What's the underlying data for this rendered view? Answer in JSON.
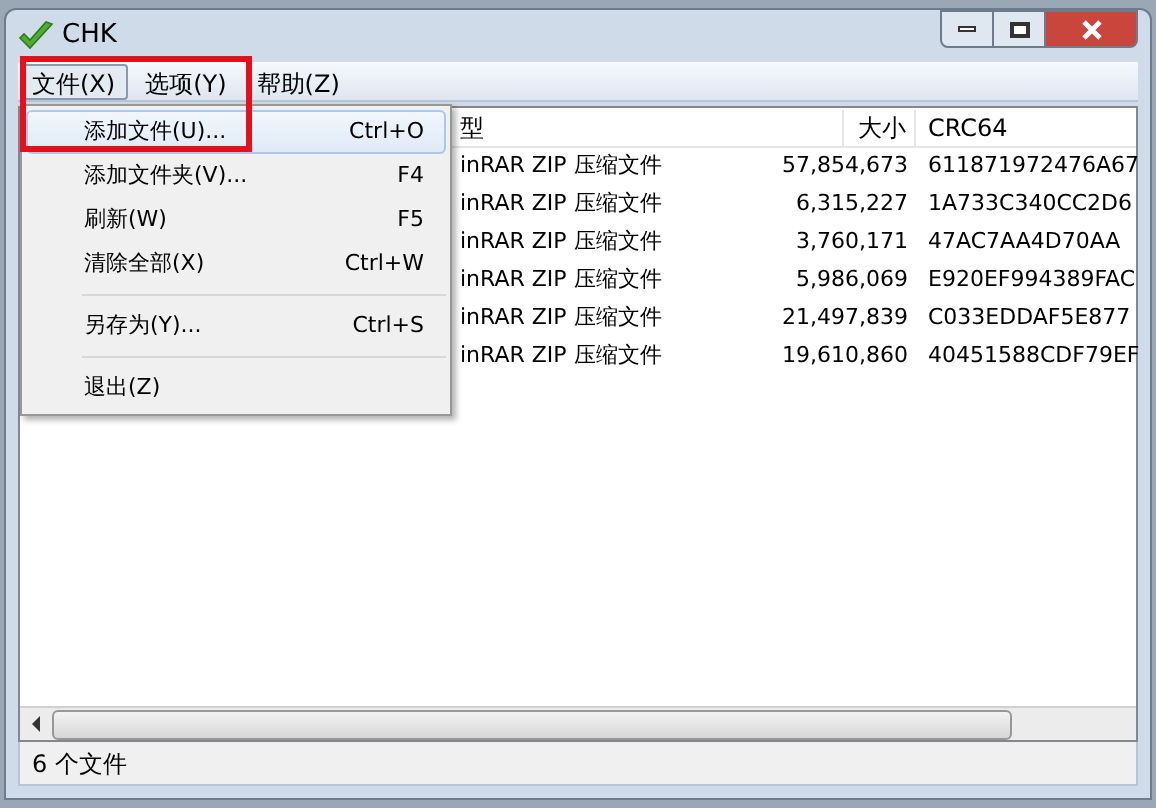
{
  "window": {
    "title": "CHK"
  },
  "menu_bar": [
    {
      "label": "文件(X)",
      "selected": true
    },
    {
      "label": "选项(Y)",
      "selected": false
    },
    {
      "label": "帮助(Z)",
      "selected": false
    }
  ],
  "file_menu": [
    {
      "kind": "item",
      "label": "添加文件(U)...",
      "shortcut": "Ctrl+O",
      "selected": true
    },
    {
      "kind": "item",
      "label": "添加文件夹(V)...",
      "shortcut": "F4",
      "selected": false
    },
    {
      "kind": "item",
      "label": "刷新(W)",
      "shortcut": "F5",
      "selected": false
    },
    {
      "kind": "item",
      "label": "清除全部(X)",
      "shortcut": "Ctrl+W",
      "selected": false
    },
    {
      "kind": "separator"
    },
    {
      "kind": "item",
      "label": "另存为(Y)...",
      "shortcut": "Ctrl+S",
      "selected": false
    },
    {
      "kind": "separator"
    },
    {
      "kind": "item",
      "label": "退出(Z)",
      "selected": false
    }
  ],
  "table": {
    "columns": [
      "型",
      "大小",
      "CRC64"
    ],
    "rows": [
      [
        "inRAR ZIP 压缩文件",
        "57,854,673",
        "611871972476A67"
      ],
      [
        "inRAR ZIP 压缩文件",
        "6,315,227",
        "1A733C340CC2D6"
      ],
      [
        "inRAR ZIP 压缩文件",
        "3,760,171",
        "47AC7AA4D70AA"
      ],
      [
        "inRAR ZIP 压缩文件",
        "5,986,069",
        "E920EF994389FAC"
      ],
      [
        "inRAR ZIP 压缩文件",
        "21,497,839",
        "C033EDDAF5E877"
      ],
      [
        "inRAR ZIP 压缩文件",
        "19,610,860",
        "40451588CDF79EF"
      ]
    ]
  },
  "status_bar": "6 个文件"
}
